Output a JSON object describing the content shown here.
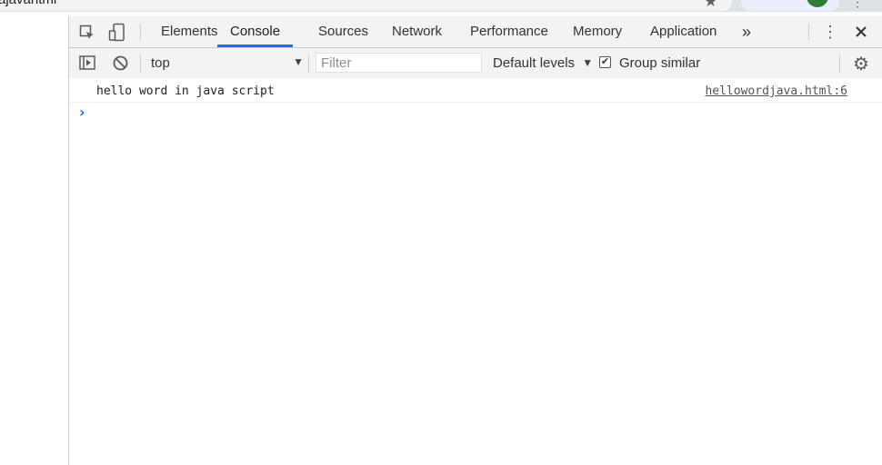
{
  "browser": {
    "omnibox_text": "ajavahtml",
    "star_icon": "star-icon",
    "menu_icon": "more-vert-icon"
  },
  "devtools": {
    "tabs": [
      {
        "label": "Elements",
        "active": false
      },
      {
        "label": "Console",
        "active": true
      },
      {
        "label": "Sources",
        "active": false
      },
      {
        "label": "Network",
        "active": false
      },
      {
        "label": "Performance",
        "active": false
      },
      {
        "label": "Memory",
        "active": false
      },
      {
        "label": "Application",
        "active": false
      }
    ],
    "more_tabs_label": "»",
    "icons": {
      "inspect": "inspect-element-icon",
      "device": "device-toolbar-icon",
      "kebab": "more-options-icon",
      "close": "close-icon"
    },
    "accent_color": "#1a73e8"
  },
  "console_toolbar": {
    "context_value": "top",
    "filter_placeholder": "Filter",
    "levels_label": "Default levels",
    "group_similar_label": "Group similar",
    "group_similar_checked": true
  },
  "console": {
    "messages": [
      {
        "text": "hello word in java script",
        "source": "hellowordjava.html:6"
      }
    ],
    "prompt_symbol": "›"
  }
}
